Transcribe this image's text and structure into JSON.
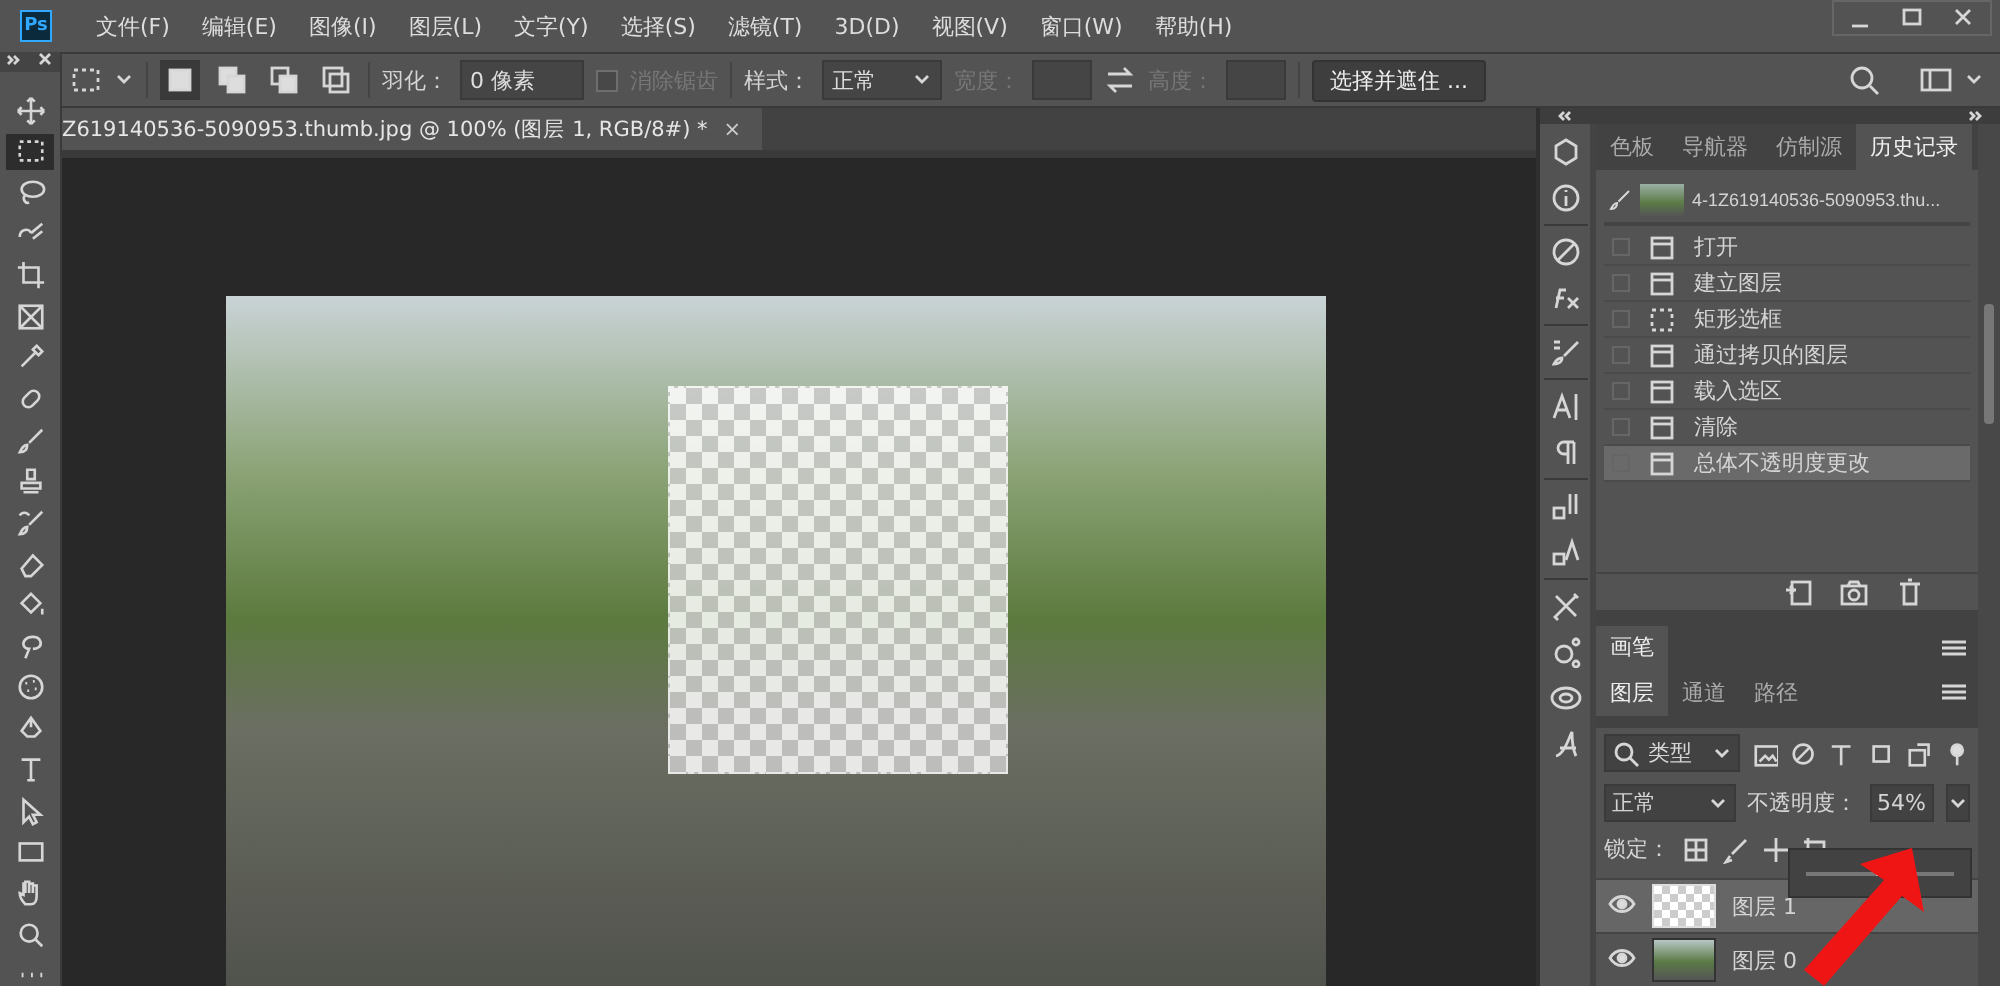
{
  "app_logo": "Ps",
  "menu": [
    "文件(F)",
    "编辑(E)",
    "图像(I)",
    "图层(L)",
    "文字(Y)",
    "选择(S)",
    "滤镜(T)",
    "3D(D)",
    "视图(V)",
    "窗口(W)",
    "帮助(H)"
  ],
  "options_bar": {
    "selection_modes": [
      {
        "selected": true
      },
      {
        "selected": false
      },
      {
        "selected": false
      },
      {
        "selected": false
      }
    ],
    "feather_label": "羽化：",
    "feather_value": "0 像素",
    "antialias": {
      "label": "消除锯齿",
      "checked": false,
      "disabled": true
    },
    "style_label": "样式：",
    "style_value": "正常",
    "width": {
      "label": "宽度：",
      "disabled": true
    },
    "height": {
      "label": "高度：",
      "disabled": true
    },
    "select_mask_button": "选择并遮住 ..."
  },
  "tools": [
    {
      "selected": false
    },
    {
      "selected": true
    },
    {
      "selected": false
    },
    {
      "selected": false
    },
    {
      "selected": false
    },
    {
      "selected": false
    },
    {
      "selected": false
    },
    {
      "selected": false
    },
    {
      "selected": false
    },
    {
      "selected": false
    },
    {
      "selected": false
    },
    {
      "selected": false
    },
    {
      "selected": false
    },
    {
      "selected": false
    },
    {
      "selected": false
    },
    {
      "selected": false
    },
    {
      "selected": false
    },
    {
      "selected": false
    },
    {
      "selected": false
    },
    {
      "selected": false
    },
    {
      "selected": false
    },
    {
      "selected": false
    }
  ],
  "document": {
    "tab_title": "Z619140536-5090953.thumb.jpg @ 100% (图层 1, RGB/8#) *",
    "close": "×"
  },
  "history_panel": {
    "tabs": [
      {
        "label": "色板",
        "selected": false
      },
      {
        "label": "导航器",
        "selected": false
      },
      {
        "label": "仿制源",
        "selected": false
      },
      {
        "label": "历史记录",
        "selected": true
      }
    ],
    "snapshot": "4-1Z619140536-5090953.thu...",
    "items": [
      {
        "label": "打开",
        "kind": "document",
        "selected": false
      },
      {
        "label": "建立图层",
        "kind": "document",
        "selected": false
      },
      {
        "label": "矩形选框",
        "kind": "marquee",
        "selected": false
      },
      {
        "label": "通过拷贝的图层",
        "kind": "document",
        "selected": false
      },
      {
        "label": "载入选区",
        "kind": "document",
        "selected": false
      },
      {
        "label": "清除",
        "kind": "document",
        "selected": false
      },
      {
        "label": "总体不透明度更改",
        "kind": "document",
        "selected": true
      }
    ]
  },
  "brush_panel": {
    "tab": "画笔"
  },
  "layers_panel": {
    "tabs": [
      {
        "label": "图层",
        "selected": true
      },
      {
        "label": "通道",
        "selected": false
      },
      {
        "label": "路径",
        "selected": false
      }
    ],
    "filter": "类型",
    "blend_mode": "正常",
    "opacity_label": "不透明度：",
    "opacity_value": "54%",
    "opacity_slider": {
      "level": 0.54
    },
    "lock_label": "锁定：",
    "layers": [
      {
        "name": "图层 1",
        "kind": "transparent",
        "visible": true,
        "selected": true
      },
      {
        "name": "图层 0",
        "kind": "photo",
        "visible": true,
        "selected": false
      }
    ]
  }
}
